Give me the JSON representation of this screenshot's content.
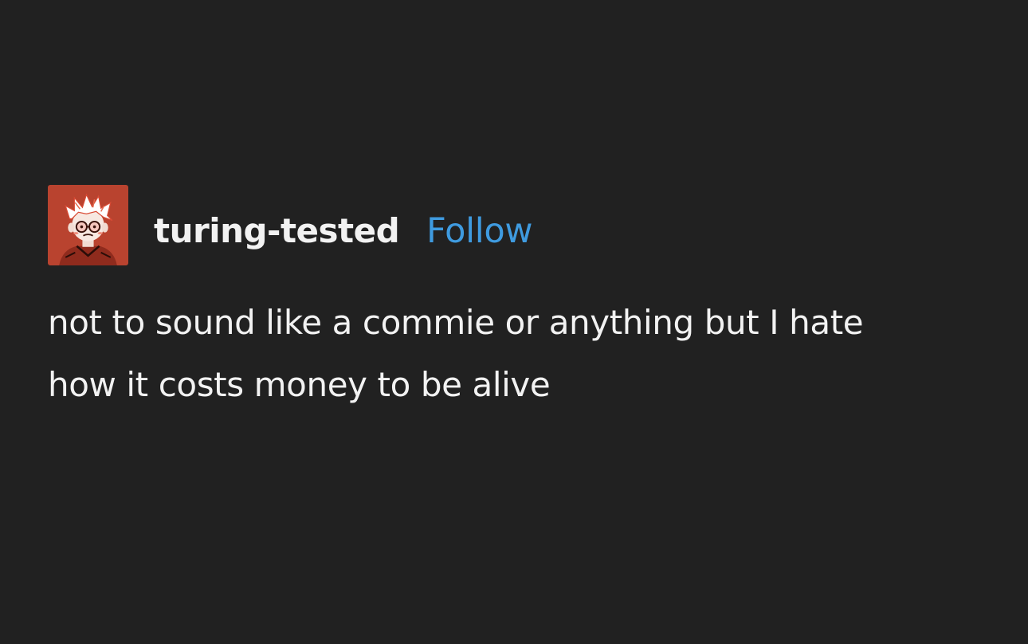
{
  "post": {
    "username": "turing-tested",
    "follow_label": "Follow",
    "body_lines": [
      "not to sound like a commie or anything but I hate",
      "how it costs money to be alive"
    ]
  },
  "colors": {
    "background": "#212121",
    "text": "#f2f2f2",
    "follow_link": "#3f9be0",
    "avatar_bg": "#b9432f"
  },
  "icons": {
    "avatar": "cartoon-character-avatar"
  }
}
